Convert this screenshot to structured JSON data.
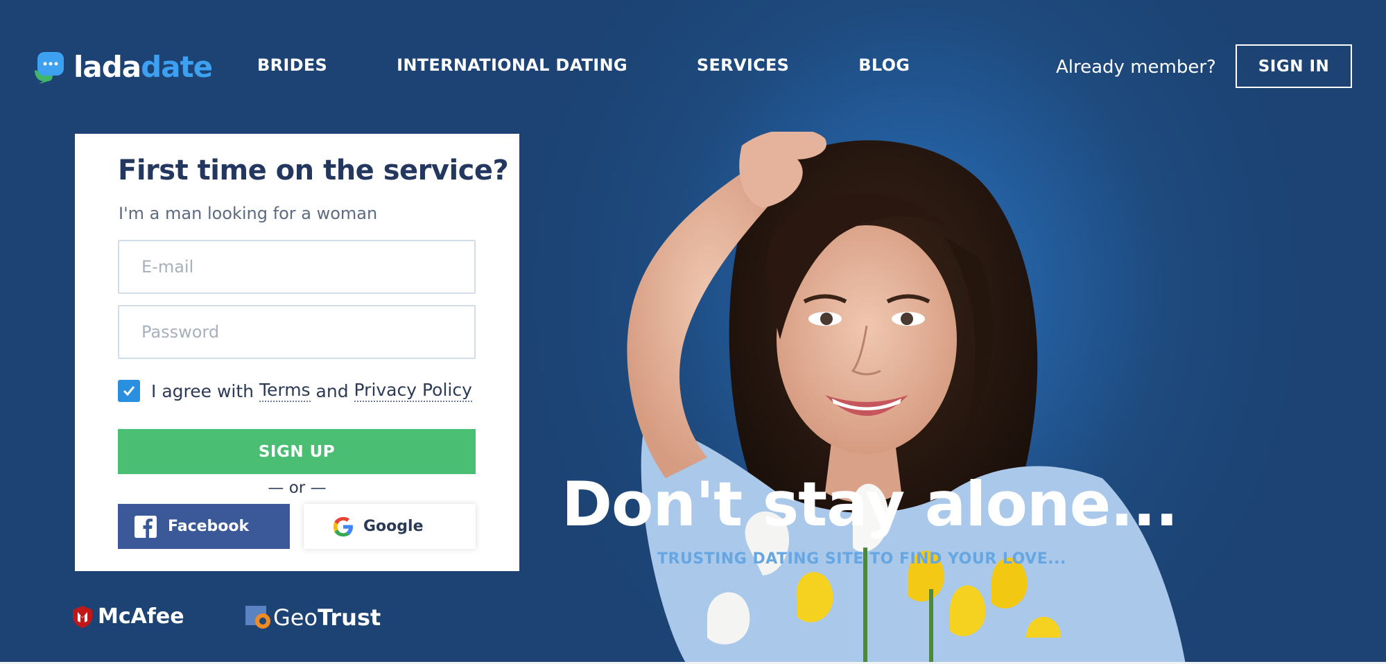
{
  "header": {
    "logo": {
      "part1": "lada",
      "part2": "date"
    },
    "nav": [
      "BRIDES",
      "INTERNATIONAL DATING",
      "SERVICES",
      "BLOG"
    ],
    "already_member": "Already member?",
    "sign_in": "SIGN IN"
  },
  "form": {
    "title": "First time on the service?",
    "subtitle": "I'm a man looking for a woman",
    "email_placeholder": "E-mail",
    "password_placeholder": "Password",
    "agree_prefix": "I agree with",
    "terms": "Terms",
    "and": "and",
    "privacy": "Privacy Policy",
    "agree_checked": true,
    "signup": "SIGN UP",
    "or": "—   or   —",
    "facebook": "Facebook",
    "google": "Google"
  },
  "badges": {
    "mcafee": "McAfee",
    "geotrust_geo": "Geo",
    "geotrust_trust": "Trust"
  },
  "hero": {
    "headline": "Don't stay alone...",
    "tagline": "TRUSTING DATING SITE TO FIND YOUR LOVE..."
  },
  "colors": {
    "background": "#1e4677",
    "accent_blue": "#3ea0f0",
    "signup_green": "#4abe72",
    "facebook_blue": "#3b5998",
    "title_navy": "#24375f"
  },
  "icons": [
    "chat-bubble-logo-icon",
    "checkbox-checked-icon",
    "facebook-icon",
    "google-icon",
    "mcafee-shield-icon",
    "geotrust-icon"
  ]
}
